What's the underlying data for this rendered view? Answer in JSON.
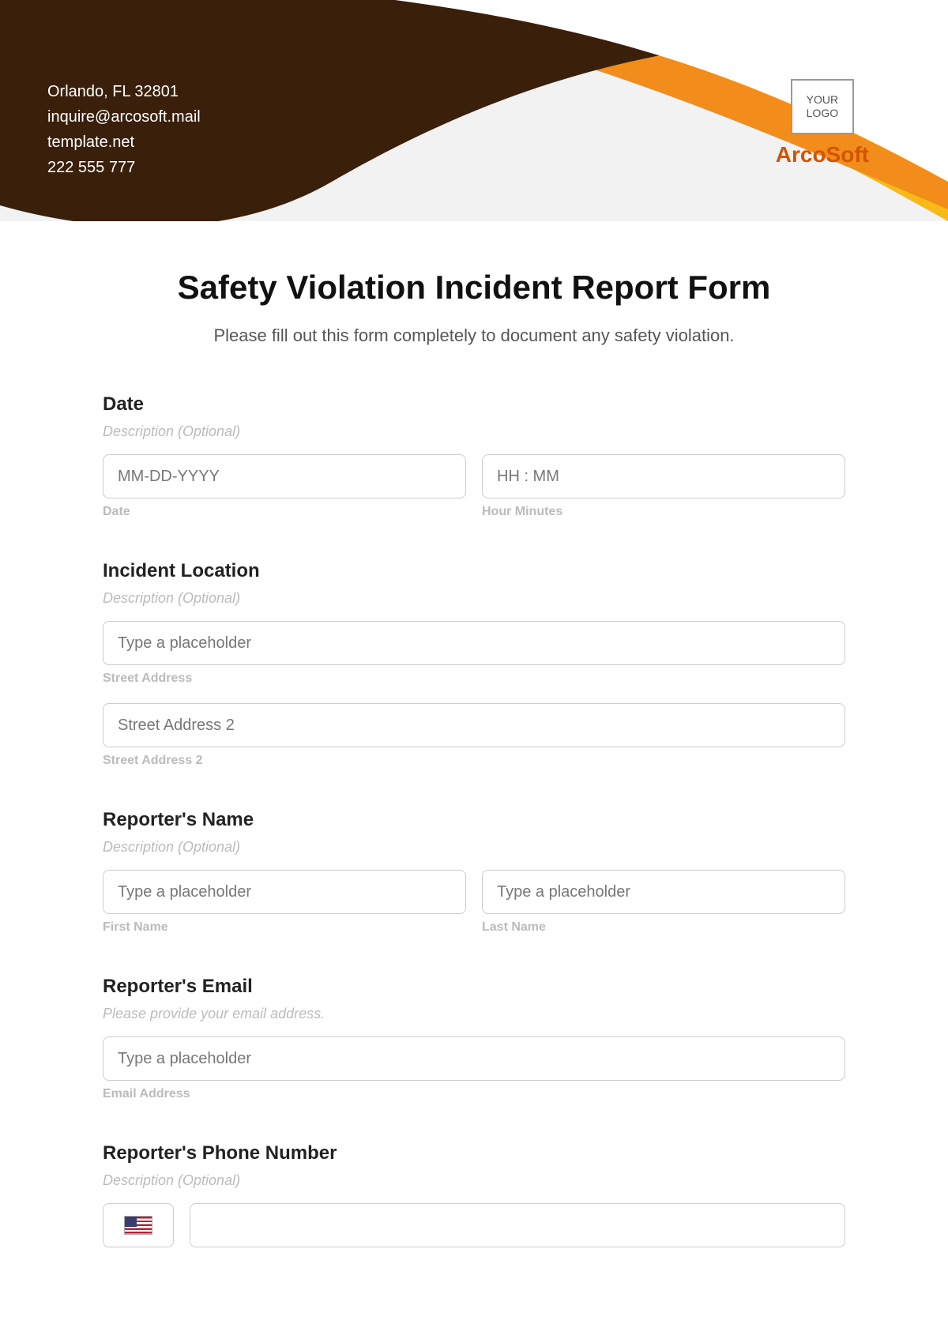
{
  "header": {
    "contact": {
      "address": "Orlando, FL 32801",
      "email": "inquire@arcosoft.mail",
      "website": "template.net",
      "phone": "222 555 777"
    },
    "logo_text": "YOUR\nLOGO",
    "brand": "ArcoSoft"
  },
  "form": {
    "title": "Safety Violation Incident Report Form",
    "subtitle": "Please fill out this form completely to document any safety violation.",
    "date": {
      "label": "Date",
      "desc": "Description (Optional)",
      "date_placeholder": "MM-DD-YYYY",
      "date_sub": "Date",
      "time_placeholder": "HH : MM",
      "time_sub": "Hour Minutes"
    },
    "location": {
      "label": "Incident Location",
      "desc": "Description (Optional)",
      "street1_placeholder": "Type a placeholder",
      "street1_sub": "Street Address",
      "street2_placeholder": "Street Address 2",
      "street2_sub": "Street Address 2"
    },
    "reporter_name": {
      "label": "Reporter's Name",
      "desc": "Description (Optional)",
      "first_placeholder": "Type a placeholder",
      "first_sub": "First Name",
      "last_placeholder": "Type a placeholder",
      "last_sub": "Last Name"
    },
    "reporter_email": {
      "label": "Reporter's Email",
      "desc": "Please provide your email address.",
      "placeholder": "Type a placeholder",
      "sub": "Email Address"
    },
    "reporter_phone": {
      "label": "Reporter's Phone Number",
      "desc": "Description (Optional)"
    }
  },
  "colors": {
    "brown": "#3a1f0b",
    "orange": "#f28c1a",
    "yellow": "#f9b917",
    "brand": "#d35400"
  }
}
